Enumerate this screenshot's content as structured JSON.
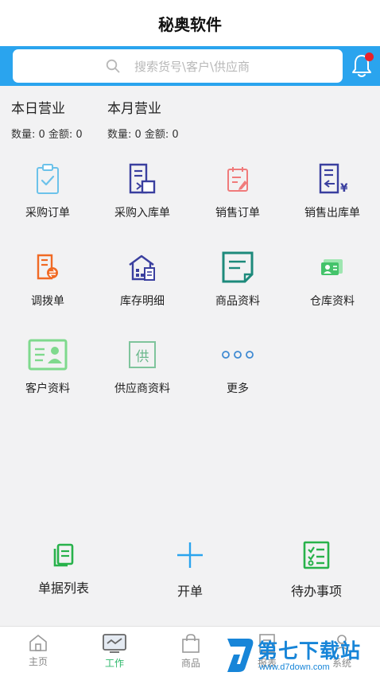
{
  "header": {
    "title": "秘奥软件"
  },
  "search": {
    "placeholder": "搜索货号\\客户\\供应商"
  },
  "stats": {
    "today": {
      "title": "本日营业",
      "summary": "数量: 0 金额: 0"
    },
    "month": {
      "title": "本月营业",
      "summary": "数量: 0 金额: 0"
    }
  },
  "grid": [
    {
      "label": "采购订单"
    },
    {
      "label": "采购入库单"
    },
    {
      "label": "销售订单"
    },
    {
      "label": "销售出库单"
    },
    {
      "label": "调拨单"
    },
    {
      "label": "库存明细"
    },
    {
      "label": "商品资料"
    },
    {
      "label": "仓库资料"
    },
    {
      "label": "客户资料"
    },
    {
      "label": "供应商资料",
      "icon_text": "供"
    },
    {
      "label": "更多"
    }
  ],
  "actions": [
    {
      "label": "单据列表"
    },
    {
      "label": "开单"
    },
    {
      "label": "待办事项"
    }
  ],
  "tabs": [
    {
      "label": "主页"
    },
    {
      "label": "工作"
    },
    {
      "label": "商品"
    },
    {
      "label": "报表"
    },
    {
      "label": "系统"
    }
  ],
  "watermark": {
    "title": "第七下载站",
    "url": "www.d7down.com"
  },
  "colors": {
    "accent": "#2aa4ee",
    "active_tab": "#2fb86b",
    "notify": "#e8212a"
  }
}
